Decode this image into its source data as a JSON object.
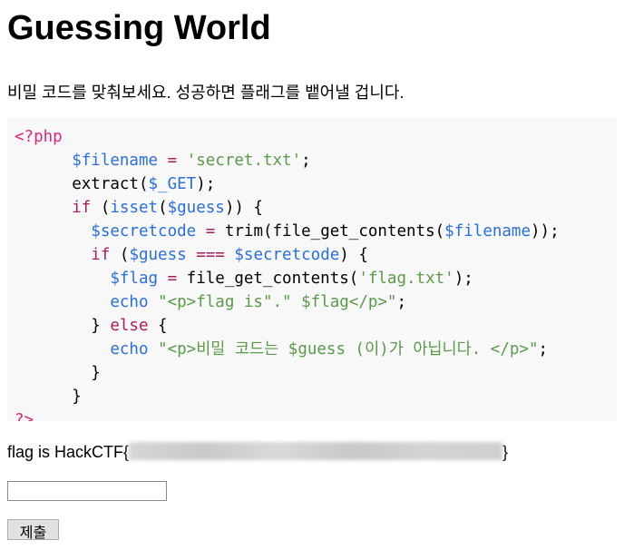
{
  "title": "Guessing World",
  "intro": "비밀 코드를 맞춰보세요. 성공하면 플래그를 뱉어낼 겁니다.",
  "code_lines": [
    [
      [
        "t",
        "<?php"
      ]
    ],
    [
      [
        "p",
        "      "
      ],
      [
        "v",
        "$filename"
      ],
      [
        "p",
        " "
      ],
      [
        "k",
        "="
      ],
      [
        "p",
        " "
      ],
      [
        "s",
        "'secret.txt'"
      ],
      [
        "p",
        ";"
      ]
    ],
    [
      [
        "p",
        "      extract("
      ],
      [
        "v",
        "$_GET"
      ],
      [
        "p",
        ");"
      ]
    ],
    [
      [
        "p",
        "      "
      ],
      [
        "k",
        "if"
      ],
      [
        "p",
        " ("
      ],
      [
        "v",
        "isset"
      ],
      [
        "p",
        "("
      ],
      [
        "v",
        "$guess"
      ],
      [
        "p",
        ")) {"
      ]
    ],
    [
      [
        "p",
        "        "
      ],
      [
        "v",
        "$secretcode"
      ],
      [
        "p",
        " "
      ],
      [
        "k",
        "="
      ],
      [
        "p",
        " trim(file_get_contents("
      ],
      [
        "v",
        "$filename"
      ],
      [
        "p",
        "));"
      ]
    ],
    [
      [
        "p",
        "        "
      ],
      [
        "k",
        "if"
      ],
      [
        "p",
        " ("
      ],
      [
        "v",
        "$guess"
      ],
      [
        "p",
        " "
      ],
      [
        "k",
        "==="
      ],
      [
        "p",
        " "
      ],
      [
        "v",
        "$secretcode"
      ],
      [
        "p",
        ") {"
      ]
    ],
    [
      [
        "p",
        "          "
      ],
      [
        "v",
        "$flag"
      ],
      [
        "p",
        " "
      ],
      [
        "k",
        "="
      ],
      [
        "p",
        " file_get_contents("
      ],
      [
        "s",
        "'flag.txt'"
      ],
      [
        "p",
        ");"
      ]
    ],
    [
      [
        "p",
        "          "
      ],
      [
        "v",
        "echo"
      ],
      [
        "p",
        " "
      ],
      [
        "s",
        "\"<p>flag is\".\" $flag</p>\""
      ],
      [
        "p",
        ";"
      ]
    ],
    [
      [
        "p",
        "        } "
      ],
      [
        "k",
        "else"
      ],
      [
        "p",
        " {"
      ]
    ],
    [
      [
        "p",
        "          "
      ],
      [
        "v",
        "echo"
      ],
      [
        "p",
        " "
      ],
      [
        "s",
        "\"<p>비밀 코드는 $guess (이)가 아닙니다. </p>\""
      ],
      [
        "p",
        ";"
      ]
    ],
    [
      [
        "p",
        "        }"
      ]
    ],
    [
      [
        "p",
        "      }"
      ]
    ],
    [
      [
        "t",
        "?>"
      ]
    ]
  ],
  "flag_prefix": "flag is HackCTF{",
  "flag_suffix": "}",
  "input_value": "",
  "submit_label": "제출",
  "colors": {
    "keyword": "#a71d5d",
    "variable": "#2a6fdb",
    "string": "#5a9a4a",
    "php_tag": "#e0247a",
    "code_bg": "#f8f8f8"
  }
}
